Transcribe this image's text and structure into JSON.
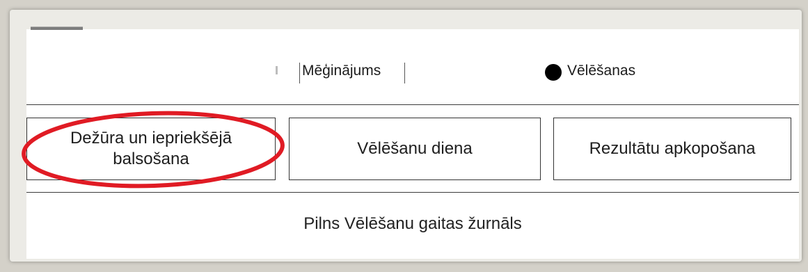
{
  "mode_options": {
    "trial_label": "Mēģinājums",
    "election_label": "Vēlēšanas",
    "selected": "Vēlēšanas"
  },
  "phase_buttons": {
    "duty_label": "Dežūra un iepriekšējā balsošana",
    "election_day_label": "Vēlēšanu diena",
    "results_label": "Rezultātu apkopošana"
  },
  "log_label": "Pilns Vēlēšanu gaitas žurnāls",
  "highlight": {
    "color": "#e01b24",
    "target": "Dežūra un iepriekšējā balsošana"
  }
}
